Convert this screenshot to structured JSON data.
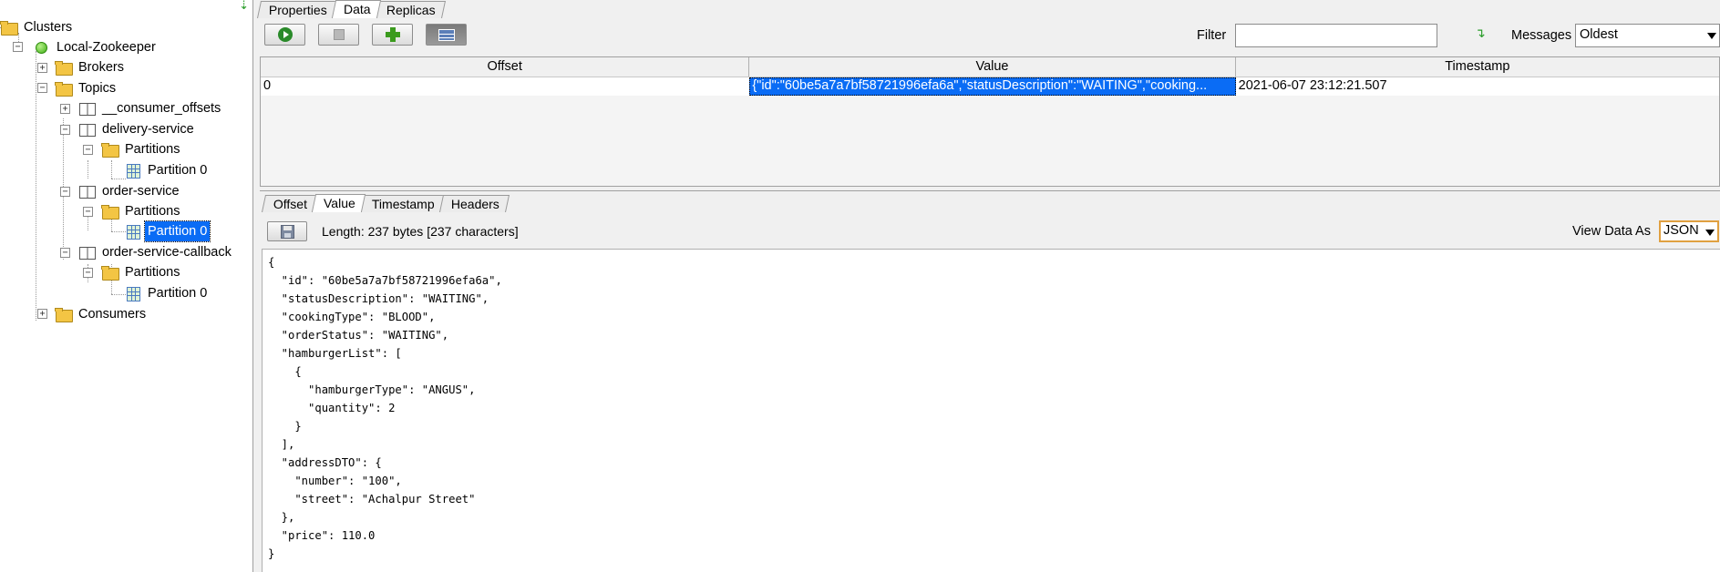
{
  "tree": {
    "nodes": [
      {
        "id": "clusters",
        "label": "Clusters",
        "icon": "folder-open-icon"
      },
      {
        "id": "local-zookeeper",
        "label": "Local-Zookeeper",
        "icon": "green-dot-icon"
      },
      {
        "id": "brokers",
        "label": "Brokers",
        "icon": "folder-icon"
      },
      {
        "id": "topics",
        "label": "Topics",
        "icon": "folder-open-icon"
      },
      {
        "id": "consumer-offsets",
        "label": "__consumer_offsets",
        "icon": "topic-book-icon"
      },
      {
        "id": "delivery-service",
        "label": "delivery-service",
        "icon": "topic-book-icon"
      },
      {
        "id": "delivery-partitions",
        "label": "Partitions",
        "icon": "folder-open-icon"
      },
      {
        "id": "delivery-partition-0",
        "label": "Partition 0",
        "icon": "partition-grid-icon"
      },
      {
        "id": "order-service",
        "label": "order-service",
        "icon": "topic-book-icon"
      },
      {
        "id": "order-partitions",
        "label": "Partitions",
        "icon": "folder-open-icon"
      },
      {
        "id": "order-partition-0",
        "label": "Partition 0",
        "icon": "partition-grid-icon",
        "selected": true
      },
      {
        "id": "order-service-callback",
        "label": "order-service-callback",
        "icon": "topic-book-icon"
      },
      {
        "id": "callback-partitions",
        "label": "Partitions",
        "icon": "folder-open-icon"
      },
      {
        "id": "callback-partition-0",
        "label": "Partition 0",
        "icon": "partition-grid-icon"
      },
      {
        "id": "consumers",
        "label": "Consumers",
        "icon": "folder-icon"
      }
    ]
  },
  "top_tabs": [
    "Properties",
    "Data",
    "Replicas"
  ],
  "active_top_tab": "Data",
  "toolbar": {
    "filter_label": "Filter",
    "filter_value": "",
    "messages_label": "Messages",
    "messages_selected": "Oldest"
  },
  "table": {
    "columns": [
      "Offset",
      "Value",
      "Timestamp"
    ],
    "rows": [
      {
        "offset": "0",
        "value": "{\"id\":\"60be5a7a7bf58721996efa6a\",\"statusDescription\":\"WAITING\",\"cooking...",
        "timestamp": "2021-06-07 23:12:21.507"
      }
    ]
  },
  "detail": {
    "tabs": [
      "Offset",
      "Value",
      "Timestamp",
      "Headers"
    ],
    "active_tab": "Value",
    "length_text": "Length: 237 bytes [237 characters]",
    "view_as_label": "View Data As",
    "view_as_selected": "JSON",
    "json_lines": [
      "{",
      "  \"id\": \"60be5a7a7bf58721996efa6a\",",
      "  \"statusDescription\": \"WAITING\",",
      "  \"cookingType\": \"BLOOD\",",
      "  \"orderStatus\": \"WAITING\",",
      "  \"hamburgerList\": [",
      "    {",
      "      \"hamburgerType\": \"ANGUS\",",
      "      \"quantity\": 2",
      "    }",
      "  ],",
      "  \"addressDTO\": {",
      "    \"number\": \"100\",",
      "    \"street\": \"Achalpur Street\"",
      "  },",
      "  \"price\": 110.0",
      "}"
    ]
  }
}
